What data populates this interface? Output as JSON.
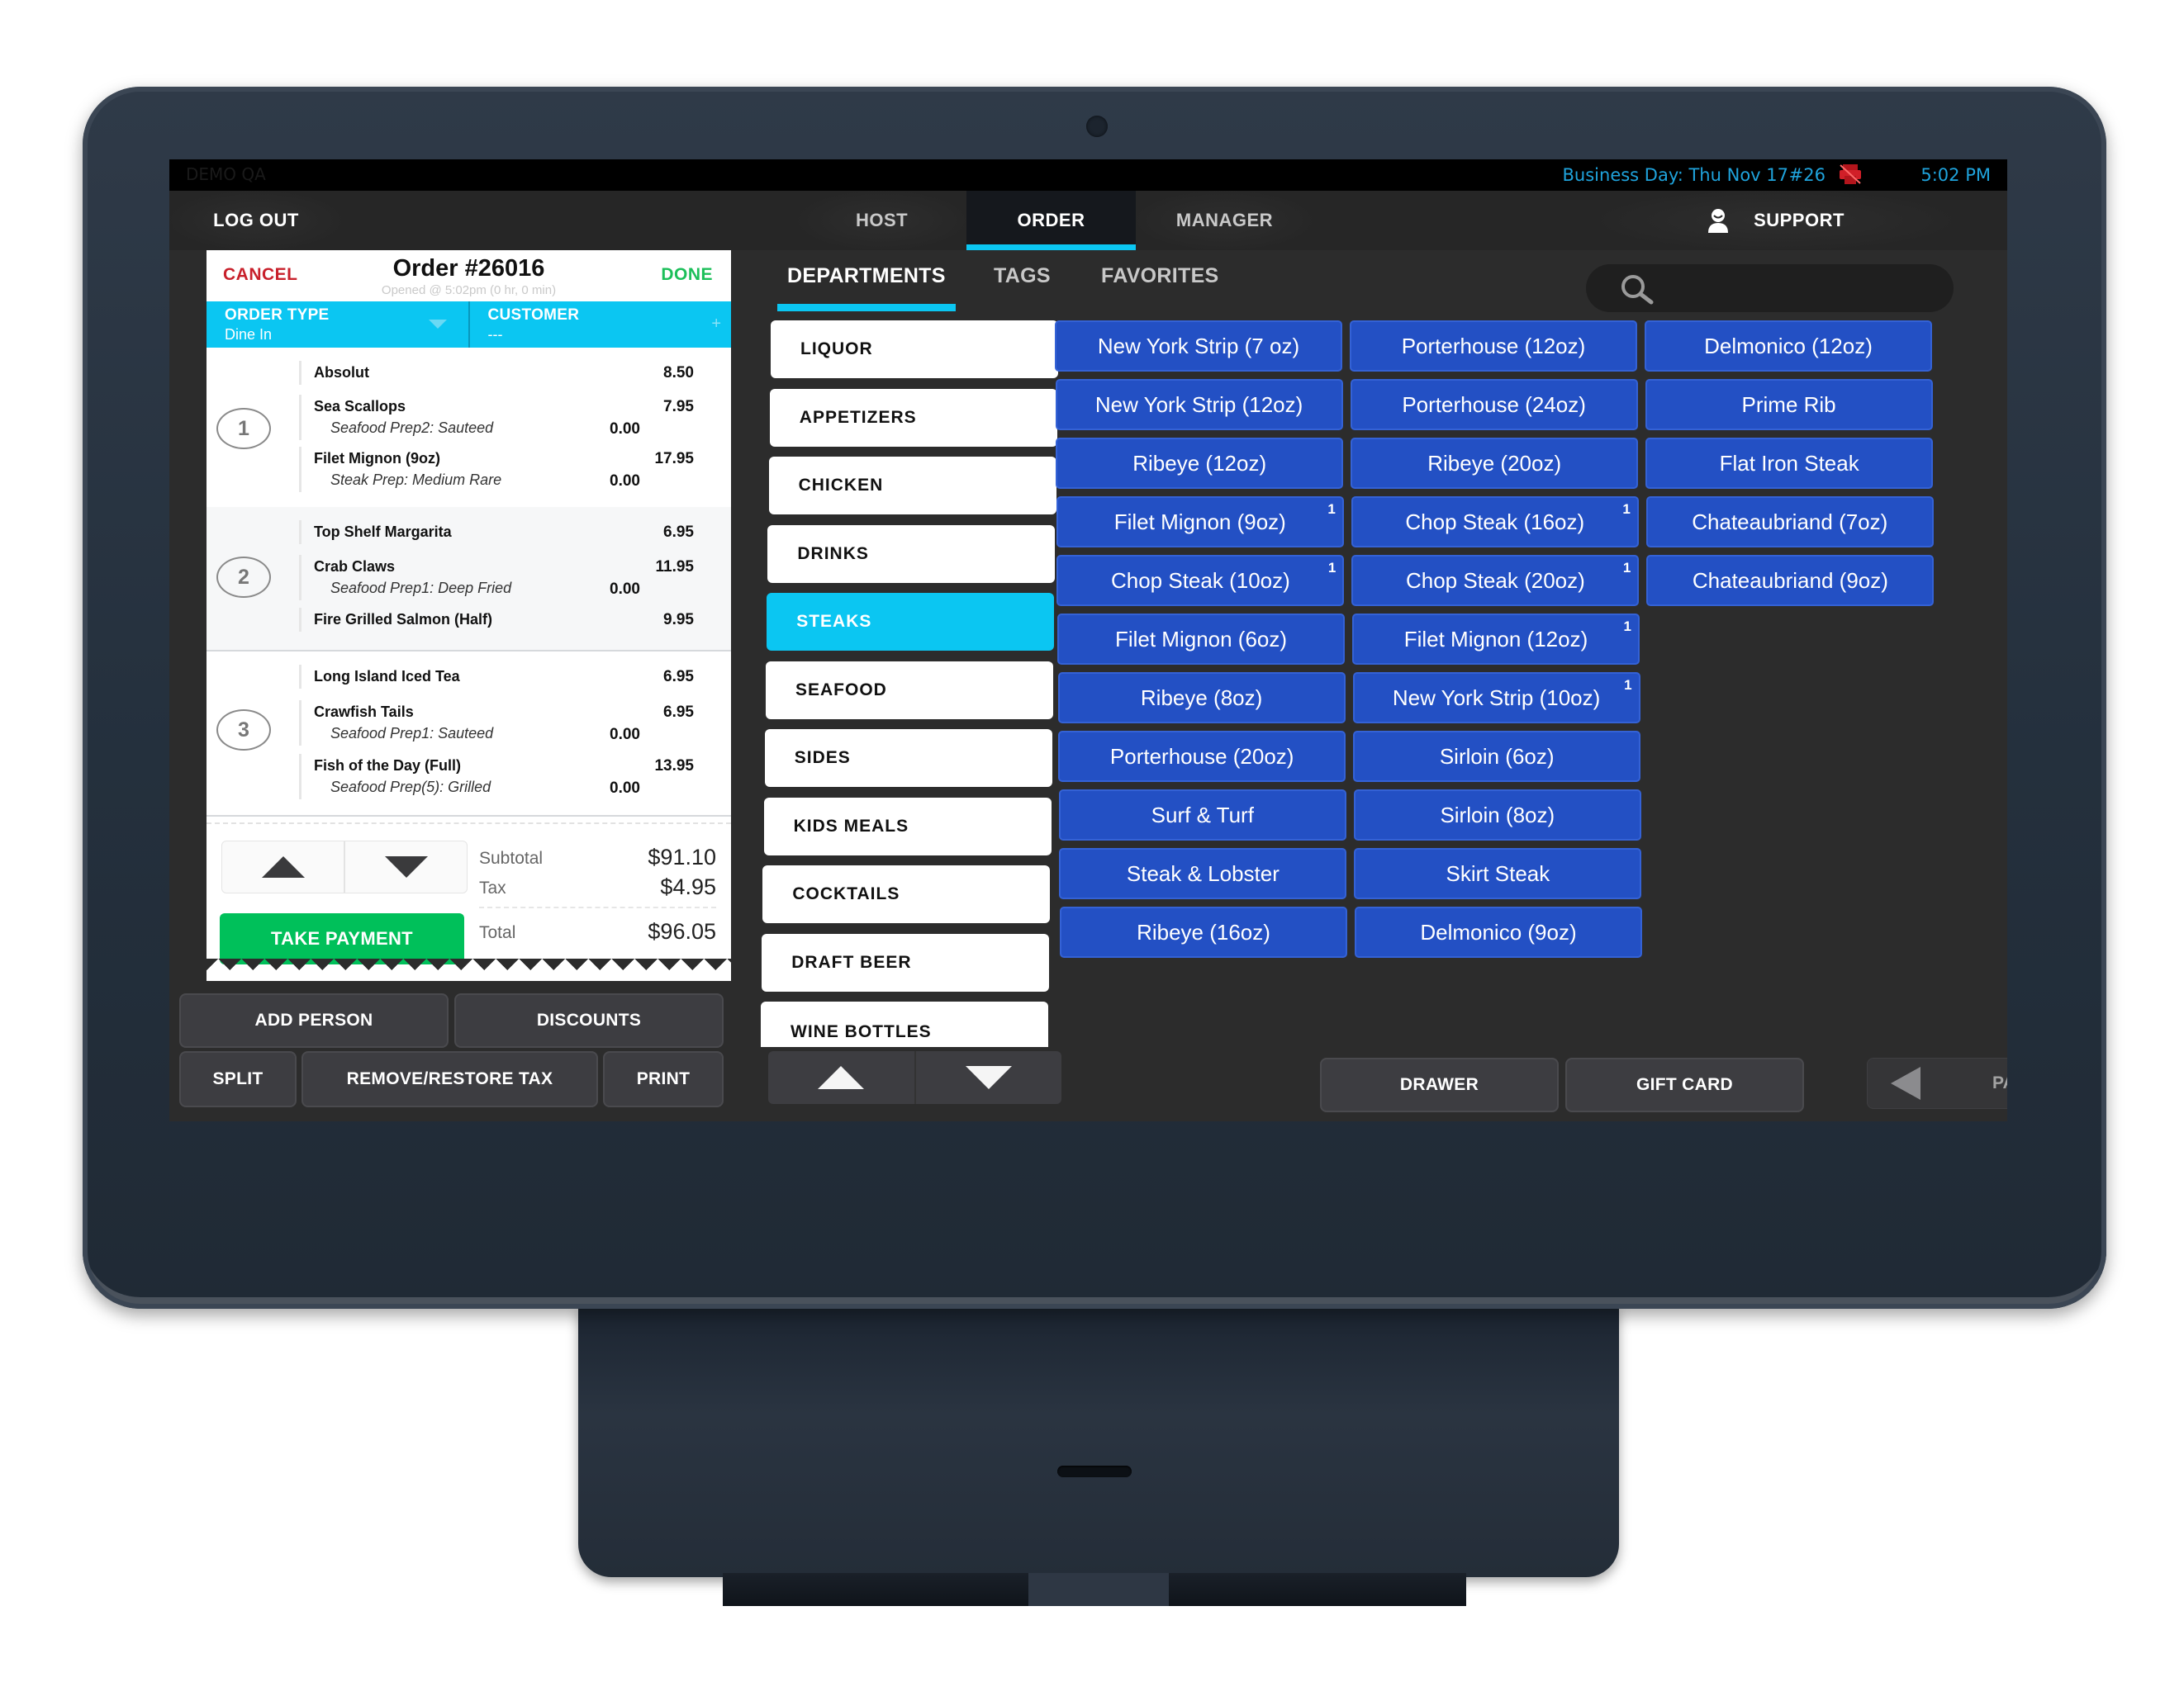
{
  "status_bar": {
    "left_text": "DEMO QA",
    "business_day": "Business Day: Thu Nov 17",
    "terminal": "#26",
    "printer_status_icon": "printer-offline-icon",
    "time": "5:02 PM",
    "accent_color": "#1fa3dc"
  },
  "nav": {
    "logout": "LOG OUT",
    "tabs": [
      {
        "label": "HOST",
        "active": false
      },
      {
        "label": "ORDER",
        "active": true
      },
      {
        "label": "MANAGER",
        "active": false
      }
    ],
    "support": "SUPPORT"
  },
  "ticket": {
    "cancel": "CANCEL",
    "title": "Order #26016",
    "opened": "Opened @ 5:02pm (0 hr, 0 min)",
    "done": "DONE",
    "order_type_label": "ORDER TYPE",
    "order_type_value": "Dine In",
    "customer_label": "CUSTOMER",
    "customer_value": "---",
    "seats": [
      {
        "number": "1",
        "items": [
          {
            "name": "Absolut",
            "price": "8.50"
          },
          {
            "name": "Sea Scallops",
            "price": "7.95",
            "modifier": "Seafood Prep2: Sauteed",
            "modifier_price": "0.00"
          },
          {
            "name": "Filet Mignon (9oz)",
            "price": "17.95",
            "modifier": "Steak Prep: Medium Rare",
            "modifier_price": "0.00"
          }
        ]
      },
      {
        "number": "2",
        "items": [
          {
            "name": "Top Shelf Margarita",
            "price": "6.95"
          },
          {
            "name": "Crab Claws",
            "price": "11.95",
            "modifier": "Seafood Prep1: Deep Fried",
            "modifier_price": "0.00"
          },
          {
            "name": "Fire Grilled Salmon (Half)",
            "price": "9.95"
          }
        ]
      },
      {
        "number": "3",
        "items": [
          {
            "name": "Long Island Iced Tea",
            "price": "6.95"
          },
          {
            "name": "Crawfish Tails",
            "price": "6.95",
            "modifier": "Seafood Prep1: Sauteed",
            "modifier_price": "0.00"
          },
          {
            "name": "Fish of the Day (Full)",
            "price": "13.95",
            "modifier": "Seafood Prep(5): Grilled",
            "modifier_price": "0.00"
          }
        ]
      }
    ],
    "subtotal_label": "Subtotal",
    "subtotal": "$91.10",
    "tax_label": "Tax",
    "tax": "$4.95",
    "total_label": "Total",
    "total": "$96.05",
    "take_payment": "TAKE PAYMENT"
  },
  "ticket_actions": {
    "add_person": "ADD PERSON",
    "discounts": "DISCOUNTS",
    "split": "SPLIT",
    "remove_restore_tax": "REMOVE/RESTORE TAX",
    "print": "PRINT"
  },
  "menu_tabs": [
    {
      "label": "DEPARTMENTS",
      "active": true
    },
    {
      "label": "TAGS",
      "active": false
    },
    {
      "label": "FAVORITES",
      "active": false
    }
  ],
  "search": {
    "placeholder": "",
    "value": ""
  },
  "departments": [
    {
      "label": "LIQUOR",
      "active": false
    },
    {
      "label": "APPETIZERS",
      "active": false
    },
    {
      "label": "CHICKEN",
      "active": false
    },
    {
      "label": "DRINKS",
      "active": false
    },
    {
      "label": "STEAKS",
      "active": true
    },
    {
      "label": "SEAFOOD",
      "active": false
    },
    {
      "label": "SIDES",
      "active": false
    },
    {
      "label": "KIDS MEALS",
      "active": false
    },
    {
      "label": "COCKTAILS",
      "active": false
    },
    {
      "label": "DRAFT BEER",
      "active": false
    },
    {
      "label": "WINE BOTTLES",
      "active": false
    }
  ],
  "menu_items": [
    {
      "label": "New York Strip (7 oz)",
      "badge": ""
    },
    {
      "label": "Porterhouse (12oz)",
      "badge": ""
    },
    {
      "label": "Delmonico (12oz)",
      "badge": ""
    },
    {
      "label": "New York Strip (12oz)",
      "badge": ""
    },
    {
      "label": "Porterhouse (24oz)",
      "badge": ""
    },
    {
      "label": "Prime Rib",
      "badge": ""
    },
    {
      "label": "Ribeye (12oz)",
      "badge": ""
    },
    {
      "label": "Ribeye (20oz)",
      "badge": ""
    },
    {
      "label": "Flat Iron Steak",
      "badge": ""
    },
    {
      "label": "Filet Mignon (9oz)",
      "badge": "1"
    },
    {
      "label": "Chop Steak (16oz)",
      "badge": "1"
    },
    {
      "label": "Chateaubriand (7oz)",
      "badge": ""
    },
    {
      "label": "Chop Steak (10oz)",
      "badge": "1"
    },
    {
      "label": "Chop Steak (20oz)",
      "badge": "1"
    },
    {
      "label": "Chateaubriand (9oz)",
      "badge": ""
    },
    {
      "label": "Filet Mignon (6oz)",
      "badge": ""
    },
    {
      "label": "Filet Mignon (12oz)",
      "badge": "1"
    },
    {
      "label": "Ribeye (8oz)",
      "badge": ""
    },
    {
      "label": "New York Strip (10oz)",
      "badge": "1"
    },
    {
      "label": "Porterhouse (20oz)",
      "badge": ""
    },
    {
      "label": "Sirloin (6oz)",
      "badge": ""
    },
    {
      "label": "Surf & Turf",
      "badge": ""
    },
    {
      "label": "Sirloin (8oz)",
      "badge": ""
    },
    {
      "label": "Steak & Lobster",
      "badge": ""
    },
    {
      "label": "Skirt Steak",
      "badge": ""
    },
    {
      "label": "Ribeye (16oz)",
      "badge": ""
    },
    {
      "label": "Delmonico (9oz)",
      "badge": ""
    }
  ],
  "bottom_bar": {
    "drawer": "DRAWER",
    "gift_card": "GIFT CARD",
    "page": "PAGE"
  },
  "colors": {
    "accent_cyan": "#0bc6f2",
    "item_blue": "#2350c4",
    "cancel_red": "#c8202b",
    "done_green": "#1cbf5a",
    "payment_green": "#00c05a"
  }
}
